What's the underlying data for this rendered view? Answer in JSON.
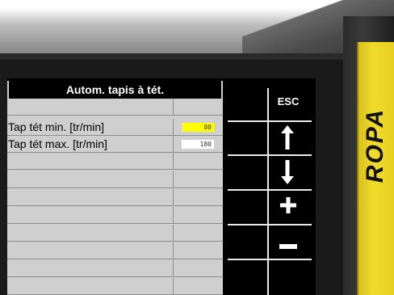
{
  "brand": {
    "logo_text": "ROPA"
  },
  "panel": {
    "title": "Autom. tapis à tét.",
    "rows": [
      {
        "label": "Tap tét min. [tr/min]",
        "value": "80",
        "value_bg": "#ffff00"
      },
      {
        "label": "Tap tét max. [tr/min]",
        "value": "180",
        "value_bg": "#ffffff"
      }
    ]
  },
  "keys": {
    "esc_label": "ESC",
    "up": "arrow-up-icon",
    "down": "arrow-down-icon",
    "plus": "plus-icon",
    "minus": "minus-icon"
  },
  "colors": {
    "brand_yellow": "#f2dc2a",
    "highlight": "#ffff00",
    "screen_bg": "#000000"
  }
}
